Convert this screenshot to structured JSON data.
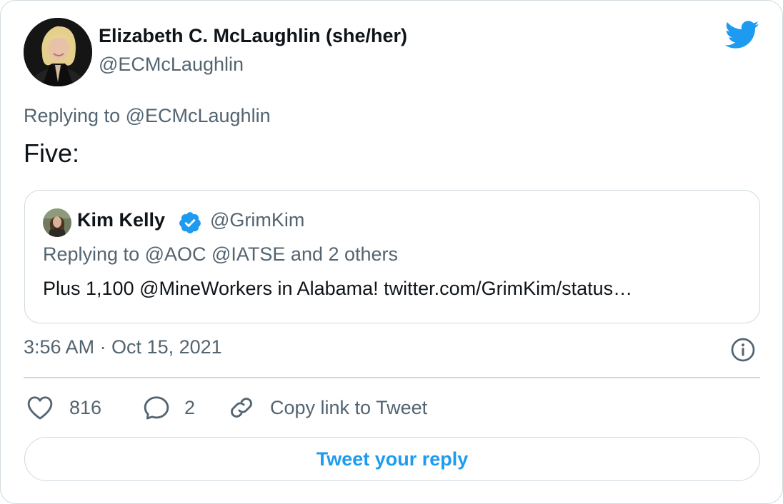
{
  "tweet": {
    "author": {
      "name": "Elizabeth C. McLaughlin (she/her)",
      "handle": "@ECMcLaughlin",
      "avatar_icon": "avatar-photo"
    },
    "replying_to": "Replying to @ECMcLaughlin",
    "text": "Five:",
    "quoted": {
      "name": "Kim Kelly",
      "verified_icon": "verified-badge-icon",
      "handle": "@GrimKim",
      "replying_to": "Replying to @AOC @IATSE and 2 others",
      "text": "Plus 1,100 @MineWorkers in Alabama! twitter.com/GrimKim/status…"
    },
    "timestamp": "3:56 AM · Oct 15, 2021",
    "actions": {
      "likes": "816",
      "replies": "2",
      "copy_label": "Copy link to Tweet"
    },
    "reply_button_label": "Tweet your reply"
  },
  "colors": {
    "twitter_blue": "#1d9bf0",
    "secondary_text": "#536471",
    "border": "#cfd9de",
    "like_icon": "#536471"
  },
  "icons": [
    "twitter-bird-icon",
    "info-icon",
    "heart-icon",
    "reply-bubble-icon",
    "link-icon"
  ]
}
